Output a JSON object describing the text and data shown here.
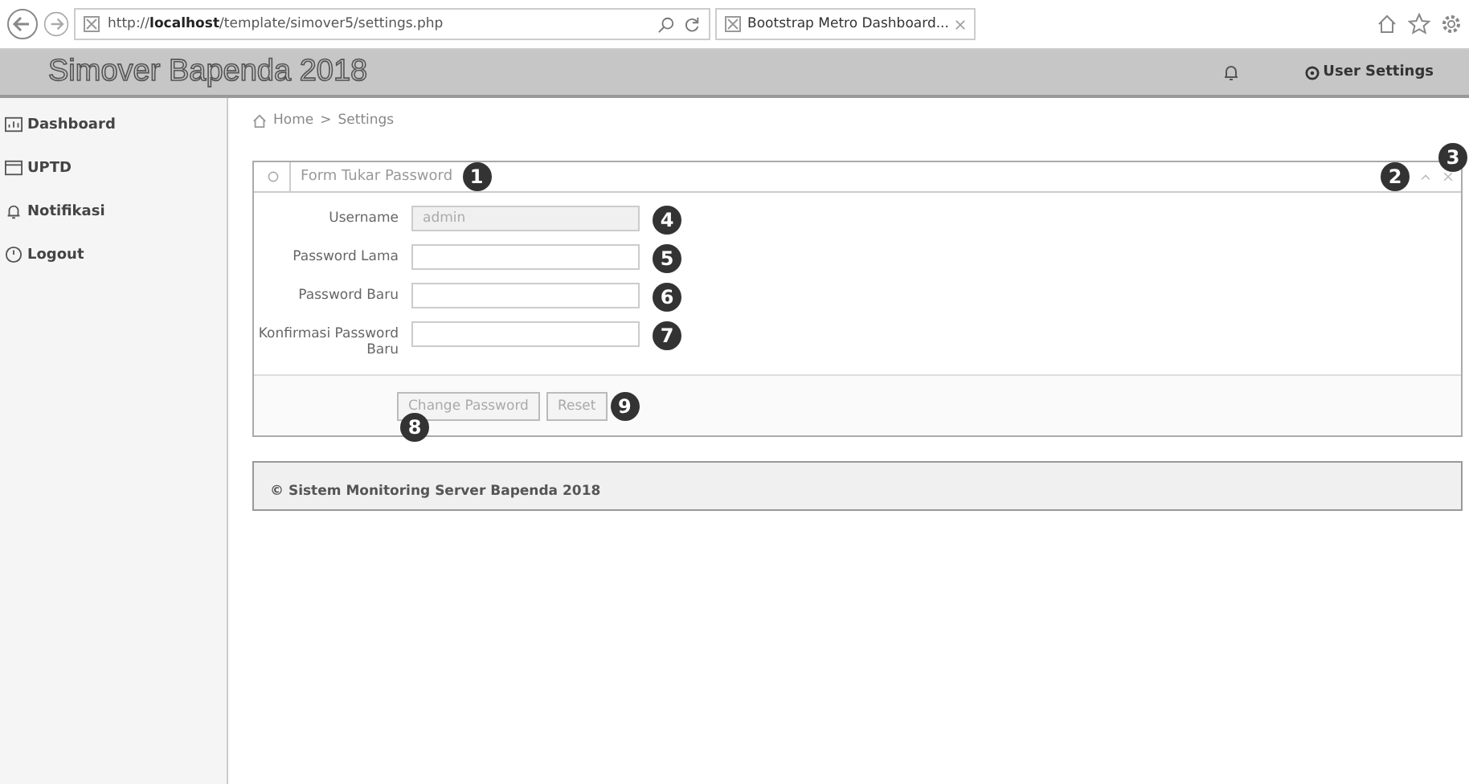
{
  "browser": {
    "url": "http://**localhost**/template/simover5/settings.php",
    "tab_title": "Bootstrap Metro Dashboard..."
  },
  "header": {
    "title": "Simover Bapenda 2018",
    "user_menu": "User Settings"
  },
  "sidebar": {
    "items": [
      {
        "label": "Dashboard"
      },
      {
        "label": "UPTD"
      },
      {
        "label": "Notifikasi"
      },
      {
        "label": "Logout"
      }
    ]
  },
  "breadcrumb": {
    "items": [
      "Home",
      "Settings"
    ],
    "separator": ">"
  },
  "panel": {
    "title": "Form Tukar Password",
    "marker": "1",
    "tool_markers": [
      "2",
      "3"
    ],
    "fields": [
      {
        "label": "Username",
        "value": "admin",
        "disabled": true,
        "marker": "4"
      },
      {
        "label": "Password Lama",
        "disabled": false,
        "marker": "5"
      },
      {
        "label": "Password Baru",
        "disabled": false,
        "marker": "6"
      },
      {
        "label": "Konfirmasi Password Baru",
        "disabled": false,
        "marker": "7"
      }
    ],
    "buttons": [
      {
        "label": "Change Password",
        "marker": "8"
      },
      {
        "label": "Reset",
        "marker": "9"
      }
    ]
  },
  "footer": "© Sistem Monitoring Server Bapenda 2018"
}
